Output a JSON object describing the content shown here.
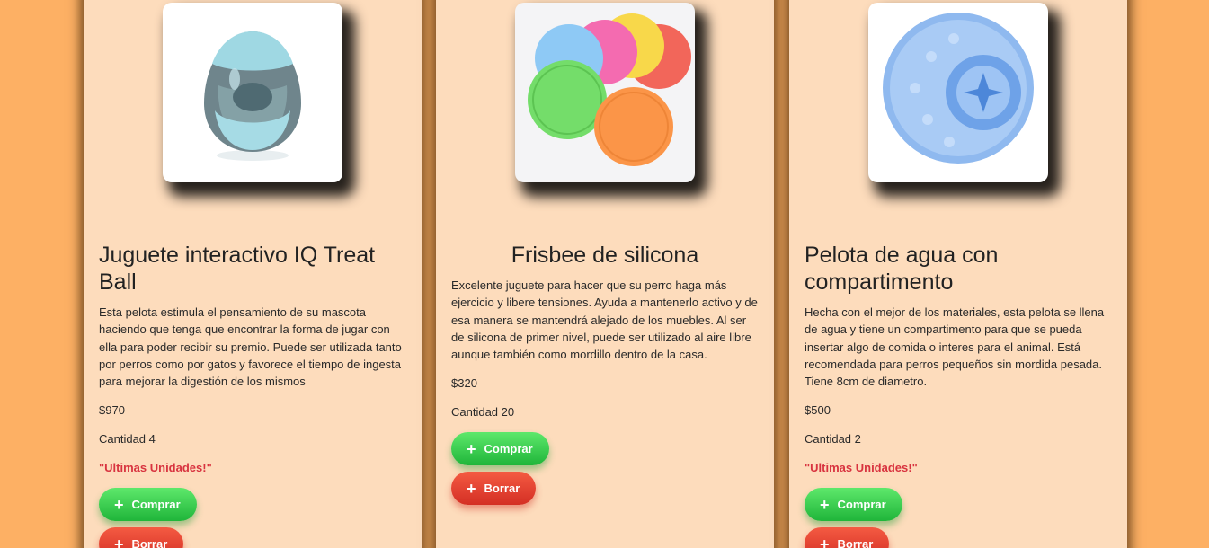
{
  "products": [
    {
      "title": "Juguete interactivo IQ Treat Ball",
      "description": "Esta pelota estimula el pensamiento de su mascota haciendo que tenga que encontrar la forma de jugar con ella para poder recibir su premio. Puede ser utilizada tanto por perros como por gatos y favorece el tiempo de ingesta para mejorar la digestión de los mismos",
      "price": "$970",
      "quantity": "Cantidad 4",
      "warning": "\"Ultimas Unidades!\"",
      "buy_label": "Comprar",
      "delete_label": "Borrar"
    },
    {
      "title": "Frisbee de silicona",
      "description": "Excelente juguete para hacer que su perro haga más ejercicio y libere tensiones. Ayuda a mantenerlo activo y de esa manera se mantendrá alejado de los muebles. Al ser de silicona de primer nivel, puede ser utilizado al aire libre aunque también como mordillo dentro de la casa.",
      "price": "$320",
      "quantity": "Cantidad 20",
      "buy_label": "Comprar",
      "delete_label": "Borrar"
    },
    {
      "title": "Pelota de agua con compartimento",
      "description": "Hecha con el mejor de los materiales, esta pelota se llena de agua y tiene un compartimento para que se pueda insertar algo de comida o interes para el animal. Está recomendada para perros pequeños sin mordida pesada. Tiene 8cm de diametro.",
      "price": "$500",
      "quantity": "Cantidad 2",
      "warning": "\"Ultimas Unidades!\"",
      "buy_label": "Comprar",
      "delete_label": "Borrar"
    }
  ],
  "icons": {
    "button_icon": "plus-icon"
  },
  "colors": {
    "page_background": "#fdb064",
    "card_background": "#fddcbc",
    "buy_button": "#2fc94b",
    "delete_button": "#e2402f",
    "warning_text": "#d8333f"
  }
}
